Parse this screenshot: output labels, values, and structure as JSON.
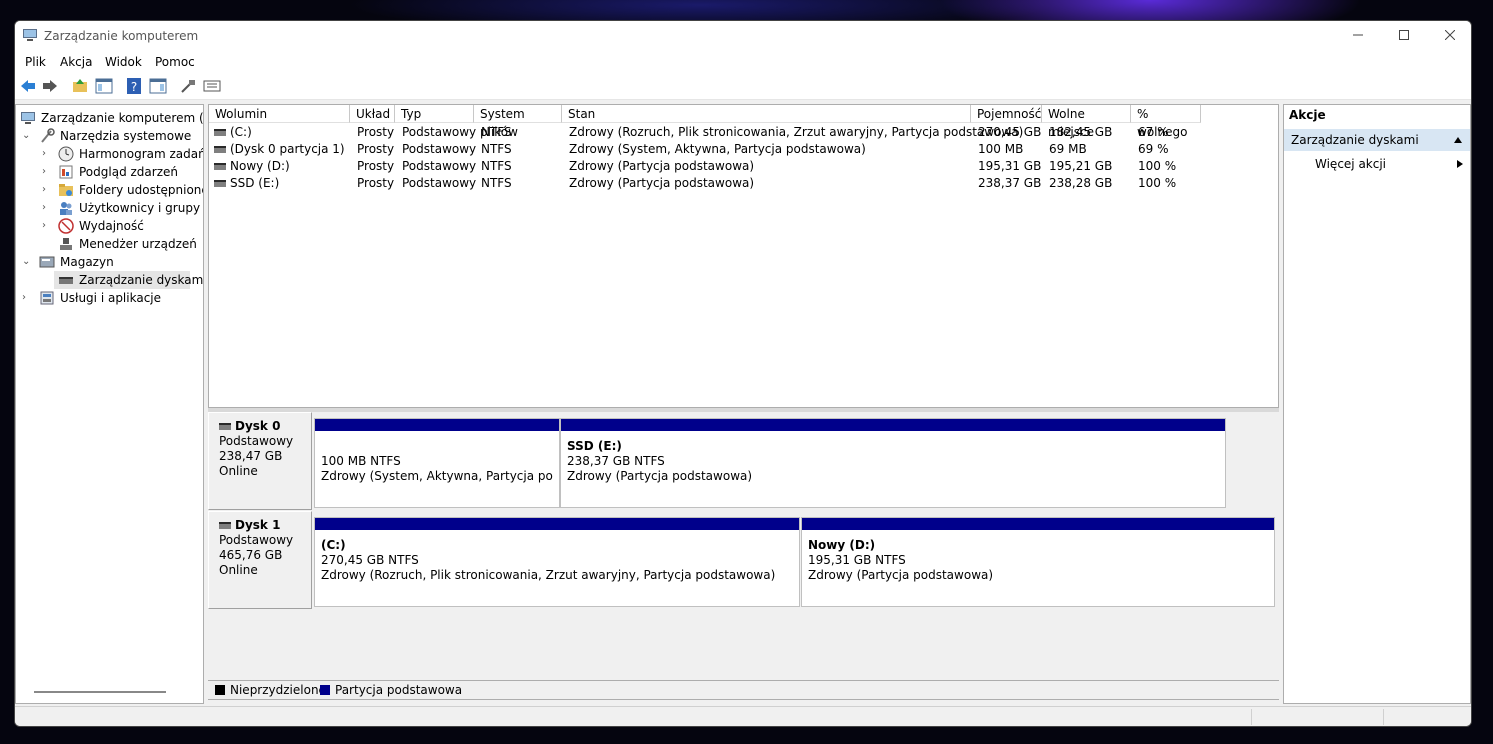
{
  "window": {
    "title": "Zarządzanie komputerem"
  },
  "menu": [
    "Plik",
    "Akcja",
    "Widok",
    "Pomoc"
  ],
  "tree": {
    "root": "Zarządzanie komputerem (loka",
    "system_tools": "Narzędzia systemowe",
    "task_scheduler": "Harmonogram zadań",
    "event_viewer": "Podgląd zdarzeń",
    "shared_folders": "Foldery udostępnione",
    "users_groups": "Użytkownicy i grupy lok",
    "performance": "Wydajność",
    "device_manager": "Menedżer urządzeń",
    "storage": "Magazyn",
    "disk_management": "Zarządzanie dyskami",
    "services_apps": "Usługi i aplikacje"
  },
  "table": {
    "headers": [
      "Wolumin",
      "Układ",
      "Typ",
      "System plików",
      "Stan",
      "Pojemność",
      "Wolne miejsce",
      "% wolnego"
    ],
    "rows": [
      [
        "(C:)",
        "Prosty",
        "Podstawowy",
        "NTFS",
        "Zdrowy (Rozruch, Plik stronicowania, Zrzut awaryjny, Partycja podstawowa)",
        "270,45 GB",
        "182,45 GB",
        "67 %"
      ],
      [
        "(Dysk 0 partycja 1)",
        "Prosty",
        "Podstawowy",
        "NTFS",
        "Zdrowy (System, Aktywna, Partycja podstawowa)",
        "100 MB",
        "69 MB",
        "69 %"
      ],
      [
        "Nowy (D:)",
        "Prosty",
        "Podstawowy",
        "NTFS",
        "Zdrowy (Partycja podstawowa)",
        "195,31 GB",
        "195,21 GB",
        "100 %"
      ],
      [
        "SSD (E:)",
        "Prosty",
        "Podstawowy",
        "NTFS",
        "Zdrowy (Partycja podstawowa)",
        "238,37 GB",
        "238,28 GB",
        "100 %"
      ]
    ]
  },
  "disks": [
    {
      "name": "Dysk 0",
      "type": "Podstawowy",
      "size": "238,47 GB",
      "status": "Online",
      "partitions": [
        {
          "title": "",
          "size": "100 MB NTFS",
          "status": "Zdrowy (System, Aktywna, Partycja podstawowa)"
        },
        {
          "title": "SSD  (E:)",
          "size": "238,37 GB NTFS",
          "status": "Zdrowy (Partycja podstawowa)"
        }
      ]
    },
    {
      "name": "Dysk 1",
      "type": "Podstawowy",
      "size": "465,76 GB",
      "status": "Online",
      "partitions": [
        {
          "title": " (C:)",
          "size": "270,45 GB NTFS",
          "status": "Zdrowy (Rozruch, Plik stronicowania, Zrzut awaryjny, Partycja podstawowa)"
        },
        {
          "title": "Nowy  (D:)",
          "size": "195,31 GB NTFS",
          "status": "Zdrowy (Partycja podstawowa)"
        }
      ]
    }
  ],
  "legend": {
    "unallocated": "Nieprzydzielone",
    "primary": "Partycja podstawowa",
    "unallocated_color": "#000000",
    "primary_color": "#00008b"
  },
  "actions": {
    "header": "Akcje",
    "section": "Zarządzanie dyskami",
    "more": "Więcej akcji"
  }
}
